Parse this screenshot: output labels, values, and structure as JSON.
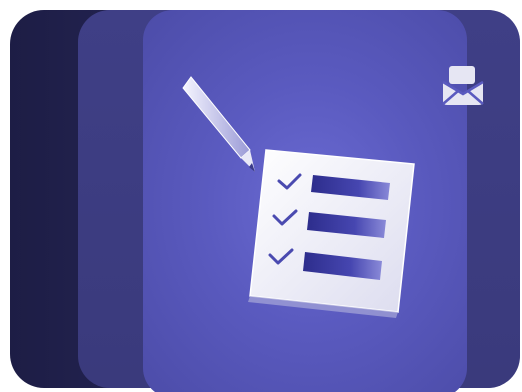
{
  "icons": {
    "mail": "open-envelope-icon",
    "pencil": "pencil-icon",
    "checklist": "checklist-icon"
  },
  "checklist": {
    "items": [
      {
        "checked": true
      },
      {
        "checked": true
      },
      {
        "checked": true
      }
    ]
  },
  "colors": {
    "back_card": "#1d1d45",
    "mid_card": "#3f3f86",
    "front_card": "#5a5abf",
    "paper": "#f3f3fb",
    "bar": "#3a3a9e",
    "check": "#4a4ab0",
    "icon": "#e6e6f3"
  }
}
